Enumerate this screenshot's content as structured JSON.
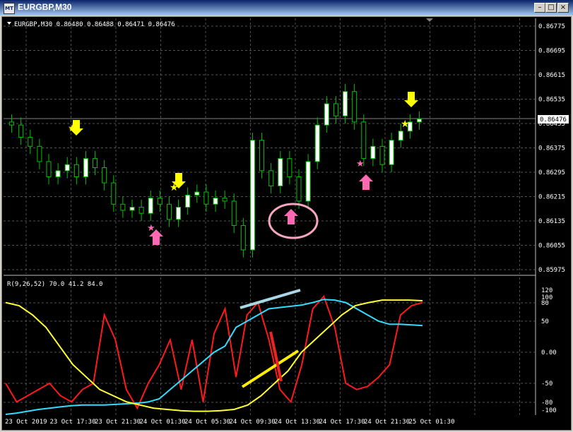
{
  "window": {
    "title": "EURGBP,M30",
    "icon": "mt4-chart-icon",
    "buttons": [
      "minimize",
      "maximize",
      "close"
    ]
  },
  "main_header": "EURGBP,M30  0.86480 0.86488 0.86471 0.86476",
  "main_price_ticks": [
    "0.86775",
    "0.86695",
    "0.86615",
    "0.86535",
    "0.86455",
    "0.86375",
    "0.86295",
    "0.86215",
    "0.86135",
    "0.86055",
    "0.85975"
  ],
  "current_price": "0.86476",
  "indicator_header": "R(9,26,52) 70.0 41.2 84.0",
  "indicator_ticks": [
    "120",
    "100",
    "80",
    "50",
    "0.00",
    "-50",
    "-80",
    "-100"
  ],
  "time_labels": [
    "23 Oct 2019",
    "23 Oct 17:30",
    "23 Oct 21:30",
    "24 Oct 01:30",
    "24 Oct 05:30",
    "24 Oct 09:30",
    "24 Oct 13:30",
    "24 Oct 17:30",
    "24 Oct 21:30",
    "25 Oct 01:30"
  ],
  "colors": {
    "background": "#000000",
    "candle": "#00c000",
    "bull_body": "#ffffff",
    "signal_down": "#ffff00",
    "signal_up": "#ff66cc",
    "fast_line": "#ff1a1a",
    "mid_line": "#33ddff",
    "slow_line": "#ffff33"
  },
  "chart_data": {
    "type": "line",
    "title": "EURGBP,M30",
    "ylim_price": [
      0.85975,
      0.86775
    ],
    "price_close": [
      0.8645,
      0.8641,
      0.8638,
      0.8633,
      0.8628,
      0.863,
      0.8632,
      0.8628,
      0.8634,
      0.8631,
      0.8626,
      0.8619,
      0.8617,
      0.8618,
      0.8616,
      0.8621,
      0.8619,
      0.8614,
      0.8618,
      0.8622,
      0.8623,
      0.8619,
      0.8621,
      0.862,
      0.8612,
      0.8604,
      0.864,
      0.863,
      0.8625,
      0.8634,
      0.8628,
      0.862,
      0.8633,
      0.8645,
      0.8652,
      0.8648,
      0.8656,
      0.8646,
      0.8634,
      0.8638,
      0.8632,
      0.864,
      0.8643,
      0.8646,
      0.8647
    ],
    "indicator_series": [
      {
        "values": [
          -50,
          -80,
          -70,
          -60,
          -50,
          -70,
          -80,
          -60,
          -50,
          60,
          20,
          -60,
          -90,
          -50,
          -20,
          20,
          -60,
          20,
          -80,
          30,
          70,
          -40,
          60,
          80,
          20,
          -60,
          -80,
          -20,
          70,
          90,
          40,
          -50,
          -60,
          -55,
          -40,
          -20,
          60,
          75,
          80
        ]
      },
      {
        "values": [
          -100,
          -98,
          -95,
          -92,
          -90,
          -88,
          -86,
          -85,
          -85,
          -85,
          -84,
          -83,
          -82,
          -80,
          -75,
          -60,
          -45,
          -30,
          -15,
          0,
          10,
          40,
          50,
          60,
          70,
          72,
          74,
          76,
          80,
          85,
          84,
          80,
          70,
          60,
          50,
          45,
          45,
          44,
          43
        ]
      },
      {
        "values": [
          80,
          75,
          60,
          40,
          10,
          -20,
          -40,
          -60,
          -70,
          -80,
          -85,
          -90,
          -92,
          -94,
          -95,
          -95,
          -94,
          -92,
          -85,
          -70,
          -50,
          -30,
          0,
          20,
          40,
          60,
          75,
          80,
          84,
          84,
          84,
          83
        ]
      }
    ]
  }
}
